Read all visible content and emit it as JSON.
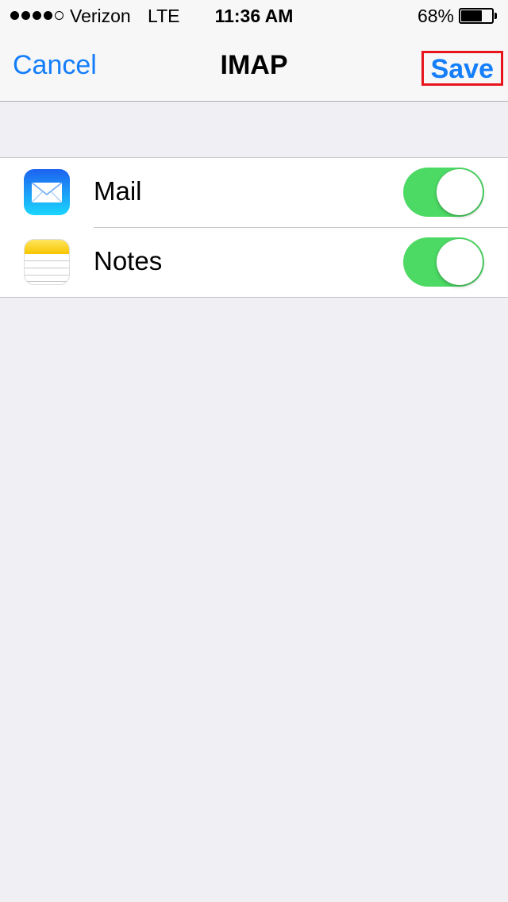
{
  "status_bar": {
    "signal_bars_filled": 4,
    "signal_bars_total": 5,
    "carrier": "Verizon",
    "network": "LTE",
    "time": "11:36 AM",
    "battery_percent_label": "68%",
    "battery_level": 0.68
  },
  "nav": {
    "cancel_label": "Cancel",
    "title": "IMAP",
    "save_label": "Save"
  },
  "settings": {
    "items": [
      {
        "label": "Mail",
        "icon": "mail-icon",
        "enabled": true
      },
      {
        "label": "Notes",
        "icon": "notes-icon",
        "enabled": true
      }
    ]
  },
  "colors": {
    "accent": "#157efb",
    "toggle_on": "#4cd964",
    "highlight_box": "#e8141b",
    "background": "#efeff4"
  }
}
